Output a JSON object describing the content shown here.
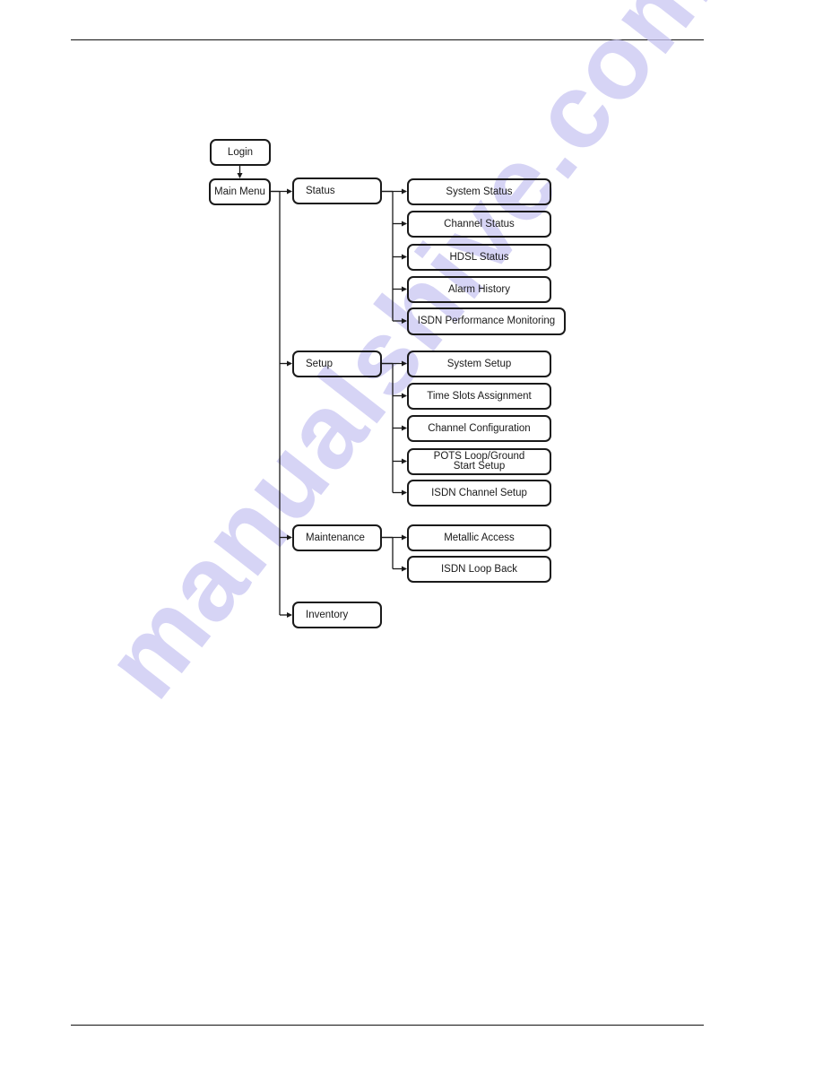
{
  "page": {
    "watermark": "manualshive.com"
  },
  "diagram": {
    "root": {
      "login": "Login",
      "main_menu": "Main Menu"
    },
    "groups": [
      {
        "label": "Status",
        "children": [
          "System Status",
          "Channel Status",
          "HDSL Status",
          "Alarm History",
          "ISDN Performance Monitoring"
        ]
      },
      {
        "label": "Setup",
        "children": [
          "System Setup",
          "Time Slots Assignment",
          "Channel Configuration",
          "POTS Loop/Ground Start Setup",
          "ISDN Channel Setup"
        ]
      },
      {
        "label": "Maintenance",
        "children": [
          "Metallic Access",
          "ISDN Loop Back"
        ]
      },
      {
        "label": "Inventory",
        "children": []
      }
    ],
    "pots_lines": [
      "POTS Loop/Ground",
      "Start Setup"
    ]
  }
}
